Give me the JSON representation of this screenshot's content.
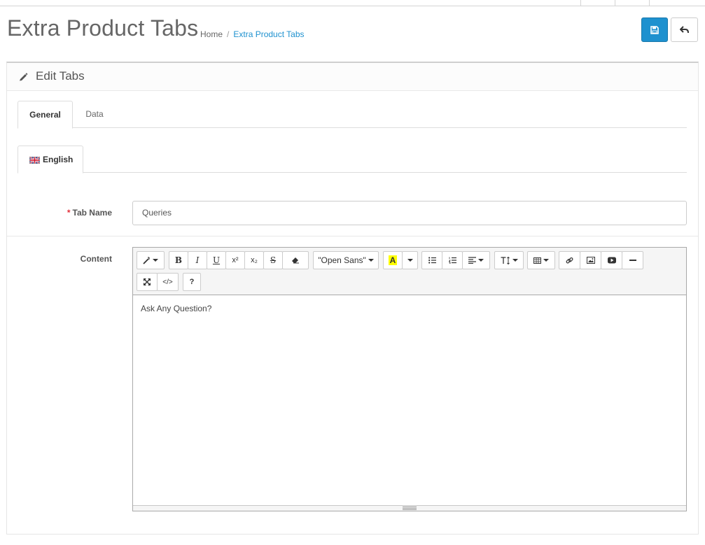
{
  "header": {
    "title": "Extra Product Tabs",
    "breadcrumb": {
      "home": "Home",
      "separator": "/",
      "current": "Extra Product Tabs"
    }
  },
  "toolbar_actions": {
    "save_icon": "save-icon",
    "back_icon": "back-arrow-icon"
  },
  "panel": {
    "title": "Edit Tabs",
    "icon": "pencil-icon",
    "tabs": [
      {
        "label": "General",
        "active": true
      },
      {
        "label": "Data",
        "active": false
      }
    ],
    "language_tabs": [
      {
        "label": "English",
        "flag": "uk-flag-icon",
        "active": true
      }
    ]
  },
  "form": {
    "tab_name": {
      "required_mark": "*",
      "label": "Tab Name",
      "value": "Queries"
    },
    "content": {
      "label": "Content",
      "text": "Ask Any Question?"
    }
  },
  "editor_toolbar": {
    "font_name": "\"Open Sans\"",
    "bold": "B",
    "italic": "I",
    "underline": "U",
    "superscript": "x²",
    "subscript": "x₂",
    "strikethrough": "S",
    "help": "?"
  },
  "colors": {
    "accent": "#1e91cf",
    "required": "#e3303b",
    "highlight": "#ffff00"
  }
}
